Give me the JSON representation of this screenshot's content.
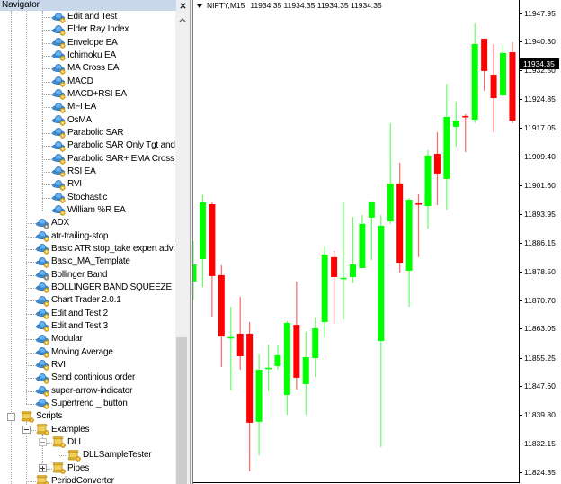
{
  "navigator": {
    "title": "Navigator",
    "tree": [
      {
        "label": "Edit and Test",
        "level": 2,
        "icon": "expert-advisor",
        "gear": "yellow"
      },
      {
        "label": "Elder Ray Index",
        "level": 2,
        "icon": "expert-advisor",
        "gear": "yellow"
      },
      {
        "label": "Envelope EA",
        "level": 2,
        "icon": "expert-advisor",
        "gear": "yellow"
      },
      {
        "label": "Ichimoku EA",
        "level": 2,
        "icon": "expert-advisor",
        "gear": "yellow"
      },
      {
        "label": "MA Cross EA",
        "level": 2,
        "icon": "expert-advisor",
        "gear": "yellow"
      },
      {
        "label": "MACD",
        "level": 2,
        "icon": "expert-advisor",
        "gear": "yellow"
      },
      {
        "label": "MACD+RSI EA",
        "level": 2,
        "icon": "expert-advisor",
        "gear": "yellow"
      },
      {
        "label": "MFI EA",
        "level": 2,
        "icon": "expert-advisor",
        "gear": "yellow"
      },
      {
        "label": "OsMA",
        "level": 2,
        "icon": "expert-advisor",
        "gear": "yellow"
      },
      {
        "label": "Parabolic SAR",
        "level": 2,
        "icon": "expert-advisor",
        "gear": "yellow"
      },
      {
        "label": "Parabolic SAR Only Tgt and",
        "level": 2,
        "icon": "expert-advisor",
        "gear": "yellow"
      },
      {
        "label": "Parabolic SAR+ EMA Cross",
        "level": 2,
        "icon": "expert-advisor",
        "gear": "yellow"
      },
      {
        "label": "RSI EA",
        "level": 2,
        "icon": "expert-advisor",
        "gear": "yellow"
      },
      {
        "label": "RVI",
        "level": 2,
        "icon": "expert-advisor",
        "gear": "yellow"
      },
      {
        "label": "Stochastic",
        "level": 2,
        "icon": "expert-advisor",
        "gear": "yellow"
      },
      {
        "label": "William %R EA",
        "level": 2,
        "icon": "expert-advisor",
        "gear": "yellow"
      },
      {
        "label": "ADX",
        "level": 1,
        "icon": "expert-advisor",
        "gear": "gray"
      },
      {
        "label": "atr-trailing-stop",
        "level": 1,
        "icon": "expert-advisor",
        "gear": "yellow"
      },
      {
        "label": "Basic ATR stop_take expert advi",
        "level": 1,
        "icon": "expert-advisor",
        "gear": "yellow"
      },
      {
        "label": "Basic_MA_Template",
        "level": 1,
        "icon": "expert-advisor",
        "gear": "yellow"
      },
      {
        "label": "Bollinger Band",
        "level": 1,
        "icon": "expert-advisor",
        "gear": "gray"
      },
      {
        "label": "BOLLINGER BAND SQUEEZE",
        "level": 1,
        "icon": "expert-advisor",
        "gear": "yellow"
      },
      {
        "label": "Chart Trader 2.0.1",
        "level": 1,
        "icon": "expert-advisor",
        "gear": "yellow"
      },
      {
        "label": "Edit and Test 2",
        "level": 1,
        "icon": "expert-advisor",
        "gear": "yellow"
      },
      {
        "label": "Edit and Test 3",
        "level": 1,
        "icon": "expert-advisor",
        "gear": "yellow"
      },
      {
        "label": "Modular",
        "level": 1,
        "icon": "expert-advisor",
        "gear": "yellow"
      },
      {
        "label": "Moving Average",
        "level": 1,
        "icon": "expert-advisor",
        "gear": "yellow"
      },
      {
        "label": "RVI",
        "level": 1,
        "icon": "expert-advisor",
        "gear": "yellow"
      },
      {
        "label": "Send continious order",
        "level": 1,
        "icon": "expert-advisor",
        "gear": "yellow"
      },
      {
        "label": "super-arrow-indicator",
        "level": 1,
        "icon": "expert-advisor",
        "gear": "yellow"
      },
      {
        "label": "Supertrend _ button",
        "level": 1,
        "icon": "expert-advisor",
        "gear": "yellow"
      },
      {
        "label": "Scripts",
        "level": 0,
        "icon": "script",
        "expander": "minus"
      },
      {
        "label": "Examples",
        "level": 1,
        "icon": "script",
        "expander": "minus"
      },
      {
        "label": "DLL",
        "level": 2,
        "icon": "script",
        "expander": "minus",
        "expander_dim": true
      },
      {
        "label": "DLLSampleTester",
        "level": 3,
        "icon": "script"
      },
      {
        "label": "Pipes",
        "level": 2,
        "icon": "script",
        "expander": "plus"
      },
      {
        "label": "PeriodConverter",
        "level": 1,
        "icon": "script"
      }
    ]
  },
  "chart": {
    "symbol_label": "NIFTY,M15",
    "ohlc_readout": "11934.35 11934.35 11934.35 11934.35",
    "current_price_label": "11934.35",
    "colors": {
      "bull": "#00ff00",
      "bear": "#ff0000",
      "background": "#ffffff",
      "frame": "#000000",
      "price_label_bg": "#000000",
      "price_label_text": "#ffffff"
    }
  },
  "chart_data": {
    "type": "bar",
    "bar_style": "candlestick",
    "title": "NIFTY,M15",
    "xlabel": "",
    "ylabel": "",
    "grid": false,
    "legend": "none",
    "ylim": [
      11821.75,
      11951.5
    ],
    "yticks": [
      11947.95,
      11940.3,
      11932.5,
      11924.85,
      11917.05,
      11909.4,
      11901.6,
      11893.95,
      11886.15,
      11878.5,
      11870.7,
      11863.05,
      11855.25,
      11847.6,
      11839.8,
      11832.15,
      11824.35
    ],
    "ytick_labels": [
      "11947.95",
      "11940.30",
      "11932.50",
      "11924.85",
      "11917.05",
      "11909.40",
      "11901.60",
      "11893.95",
      "11886.15",
      "11878.50",
      "11870.70",
      "11863.05",
      "11855.25",
      "11847.60",
      "11839.80",
      "11832.15",
      "11824.35"
    ],
    "current_price": 11934.35,
    "series": [
      {
        "name": "NIFTY,M15",
        "open": [
          11875.75,
          11881.8,
          11896.55,
          11877.45,
          11860.75,
          11861.7,
          11861.7,
          11838.0,
          11852.5,
          11853.0,
          11845.25,
          11864.1,
          11848.15,
          11855.15,
          11864.85,
          11882.3,
          11876.7,
          11876.95,
          11879.35,
          11892.95,
          11859.75,
          11891.95,
          11902.15,
          11878.65,
          11896.8,
          11896.05,
          11910.1,
          11903.35,
          11917.4,
          11920.3,
          11919.3,
          11941.1,
          11931.4,
          11925.85,
          11937.45
        ],
        "high": [
          11886.65,
          11899.0,
          11897.05,
          11880.1,
          11868.95,
          11871.65,
          11864.85,
          11856.15,
          11858.8,
          11858.55,
          11865.1,
          11875.75,
          11862.2,
          11866.05,
          11885.2,
          11883.95,
          11897.3,
          11893.15,
          11893.65,
          11897.3,
          11893.65,
          11918.35,
          11907.7,
          11898.25,
          11899.2,
          11911.1,
          11915.9,
          11929.0,
          11924.15,
          11920.75,
          11945.2,
          11941.1,
          11939.65,
          11939.4,
          11940.15
        ],
        "low": [
          11870.9,
          11874.3,
          11866.3,
          11852.75,
          11846.45,
          11852.0,
          11824.65,
          11829.0,
          11846.2,
          11852.0,
          11839.9,
          11846.7,
          11839.9,
          11850.1,
          11860.75,
          11864.35,
          11865.55,
          11875.25,
          11879.35,
          11881.55,
          11831.2,
          11891.25,
          11878.15,
          11868.95,
          11882.3,
          11890.0,
          11896.3,
          11895.1,
          11912.05,
          11910.6,
          11918.35,
          11927.05,
          11915.9,
          11925.6,
          11918.35
        ],
        "close": [
          11880.35,
          11897.05,
          11877.2,
          11860.95,
          11860.8,
          11855.65,
          11837.75,
          11852.0,
          11852.55,
          11855.9,
          11864.6,
          11849.85,
          11855.4,
          11863.15,
          11883.0,
          11876.95,
          11876.75,
          11880.35,
          11891.25,
          11897.3,
          11890.75,
          11902.15,
          11880.8,
          11897.75,
          11896.75,
          11909.65,
          11904.8,
          11920.05,
          11919.05,
          11920.2,
          11939.65,
          11932.4,
          11925.1,
          11937.25,
          11919.05
        ]
      }
    ]
  }
}
